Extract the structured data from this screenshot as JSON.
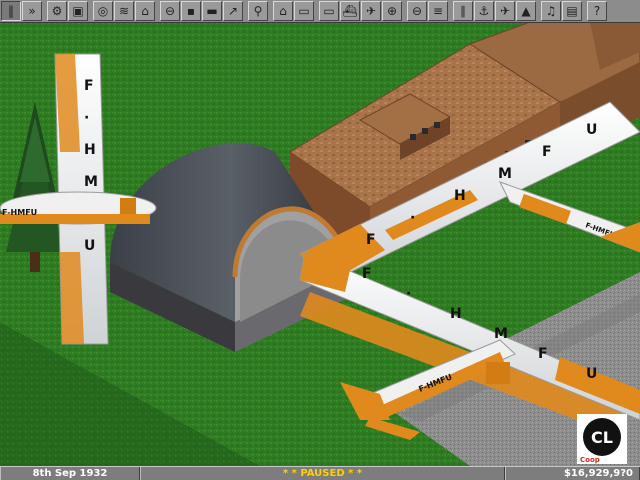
{
  "toolbar": {
    "buttons": [
      {
        "name": "pause-button",
        "icon": "pause-icon",
        "glyph": "‖",
        "pressed": true
      },
      {
        "name": "fast-forward-button",
        "icon": "fast-forward-icon",
        "glyph": "»",
        "pressed": false
      },
      {
        "name": "settings-button",
        "icon": "gear-icon",
        "glyph": "⚙",
        "pressed": false
      },
      {
        "name": "save-button",
        "icon": "floppy-disk-icon",
        "glyph": "▣",
        "pressed": false
      },
      {
        "name": "map-button",
        "icon": "compass-icon",
        "glyph": "◎",
        "pressed": false
      },
      {
        "name": "town-directory-button",
        "icon": "roads-icon",
        "glyph": "≋",
        "pressed": false
      },
      {
        "name": "subsidies-button",
        "icon": "bank-icon",
        "glyph": "⌂",
        "pressed": false
      },
      {
        "name": "station-list-button",
        "icon": "station-sign-icon",
        "glyph": "⊖",
        "pressed": false
      },
      {
        "name": "company-finances-button",
        "icon": "safe-icon",
        "glyph": "▪",
        "pressed": false
      },
      {
        "name": "company-general-button",
        "icon": "briefcase-icon",
        "glyph": "▬",
        "pressed": false
      },
      {
        "name": "graphs-button",
        "icon": "line-graph-icon",
        "glyph": "↗",
        "pressed": false
      },
      {
        "name": "company-league-button",
        "icon": "magnifier-icon",
        "glyph": "⚲",
        "pressed": false
      },
      {
        "name": "industry-button",
        "icon": "factory-icon",
        "glyph": "⌂",
        "pressed": false
      },
      {
        "name": "train-list-button",
        "icon": "train-icon",
        "glyph": "▭",
        "pressed": false
      },
      {
        "name": "road-vehicle-list-button",
        "icon": "lorry-icon",
        "glyph": "▭",
        "pressed": false
      },
      {
        "name": "ship-list-button",
        "icon": "ship-icon",
        "glyph": "⛴",
        "pressed": false
      },
      {
        "name": "aircraft-list-button",
        "icon": "airplane-icon",
        "glyph": "✈",
        "pressed": false
      },
      {
        "name": "zoom-in-button",
        "icon": "zoom-in-icon",
        "glyph": "⊕",
        "pressed": false
      },
      {
        "name": "zoom-out-button",
        "icon": "zoom-out-icon",
        "glyph": "⊖",
        "pressed": false
      },
      {
        "name": "build-railway-button",
        "icon": "rail-track-icon",
        "glyph": "≡",
        "pressed": false
      },
      {
        "name": "build-road-button",
        "icon": "road-icon",
        "glyph": "∥",
        "pressed": false
      },
      {
        "name": "build-docks-button",
        "icon": "anchor-icon",
        "glyph": "⚓",
        "pressed": false
      },
      {
        "name": "build-airport-button",
        "icon": "airport-icon",
        "glyph": "✈",
        "pressed": false
      },
      {
        "name": "landscaping-button",
        "icon": "landscape-icon",
        "glyph": "▲",
        "pressed": false
      },
      {
        "name": "music-button",
        "icon": "music-note-icon",
        "glyph": "♫",
        "pressed": false
      },
      {
        "name": "news-button",
        "icon": "newspaper-icon",
        "glyph": "▤",
        "pressed": false
      },
      {
        "name": "help-button",
        "icon": "question-icon",
        "glyph": "?",
        "pressed": false
      }
    ]
  },
  "aircraft_registration": "F-HMFU",
  "wing_lettering": [
    "F",
    "·",
    "H",
    "M",
    "F",
    "U"
  ],
  "status_bar": {
    "date": "8th Sep 1932",
    "news": "* * PAUSED * *",
    "money": "$16,929,9?0"
  },
  "watermark": {
    "text": "CL",
    "subtext": "Coop"
  },
  "colors": {
    "grass": "#2e7a22",
    "toolbar": "#8c8c8c",
    "status_text": "#ffd000",
    "aircraft_orange": "#e08a1e",
    "aircraft_white": "#f0f0f0"
  }
}
